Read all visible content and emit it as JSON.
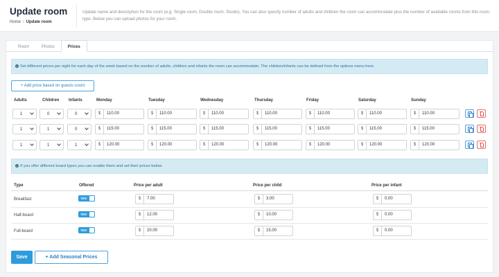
{
  "header": {
    "title": "Update room",
    "breadcrumb": {
      "home": "Home",
      "separator": "/",
      "current": "Update room"
    },
    "description": "Update name and description for the room (e.g. Single room, Double room, Studio). You can also specify number of adults and children the room can accommodate plus the number of available rooms from this room type. Below you can upload photos for your room."
  },
  "tabs": [
    {
      "label": "Room",
      "active": false
    },
    {
      "label": "Photos",
      "active": false
    },
    {
      "label": "Prices",
      "active": true
    }
  ],
  "info1": {
    "text": "Set different prices per night for each day of the week based on the number of adults, children and infants the room can accommodate. The children/infants can be defined from the options menu ",
    "link": "here",
    "end": "."
  },
  "add_price_button": "+ Add price based on guests count",
  "price_table": {
    "headers": [
      "Adults",
      "Children",
      "Infants",
      "Monday",
      "Tuesday",
      "Wednesday",
      "Thursday",
      "Friday",
      "Saturday",
      "Sunday"
    ],
    "currency": "$",
    "rows": [
      {
        "adults": "1",
        "children": "0",
        "infants": "0",
        "prices": [
          "110.00",
          "110.00",
          "110.00",
          "110.00",
          "110.00",
          "110.00",
          "110.00"
        ]
      },
      {
        "adults": "1",
        "children": "1",
        "infants": "0",
        "prices": [
          "115.00",
          "115.00",
          "115.00",
          "115.00",
          "115.00",
          "115.00",
          "115.00"
        ]
      },
      {
        "adults": "1",
        "children": "1",
        "infants": "1",
        "prices": [
          "120.00",
          "120.00",
          "120.00",
          "120.00",
          "120.00",
          "120.00",
          "120.00"
        ]
      }
    ]
  },
  "info2": {
    "text": "If you offer different board types you can enable them and set their prices below."
  },
  "board_table": {
    "headers": [
      "Type",
      "Offered",
      "Price per adult",
      "Price per child",
      "Price per infant"
    ],
    "toggle_label": "YES",
    "rows": [
      {
        "type": "Breakfast",
        "adult": "7.00",
        "child": "3.00",
        "infant": "0.00"
      },
      {
        "type": "Half-board",
        "adult": "12.00",
        "child": "10.00",
        "infant": "0.00"
      },
      {
        "type": "Full-board",
        "adult": "20.00",
        "child": "15.00",
        "infant": "0.00"
      }
    ]
  },
  "buttons": {
    "save": "Save",
    "seasonal": "+ Add Seasonal Prices"
  },
  "colors": {
    "primary": "#2e9cdc",
    "info_bg": "#d5ebf4",
    "danger": "#d9534f"
  }
}
